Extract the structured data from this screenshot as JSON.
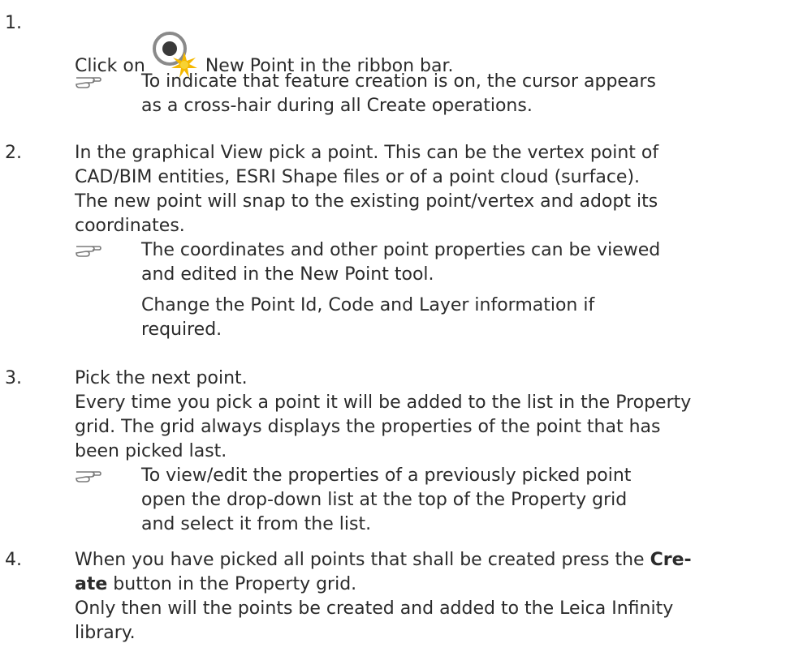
{
  "steps": [
    {
      "number": "1.",
      "line_before": "Click on",
      "icon": "new-point-icon",
      "line_after": "New Point in the ribbon bar.",
      "note_icon": "pointing-hand-icon",
      "note": [
        "To indicate that feature creation is on, the cursor appears",
        "as a cross-hair during all Create operations."
      ]
    },
    {
      "number": "2.",
      "text": [
        "In the graphical View pick a point. This can be the vertex point of",
        "CAD/BIM entities, ESRI Shape files or of a point cloud (surface).",
        "The new point will snap to the existing point/vertex and adopt its",
        "coordinates."
      ],
      "note_icon": "pointing-hand-icon",
      "note": [
        "The coordinates and other point properties can be viewed",
        "and edited in the New Point tool."
      ],
      "note_extra": [
        "Change the Point Id, Code and Layer information if",
        "required."
      ]
    },
    {
      "number": "3.",
      "text": [
        "Pick the next point.",
        "Every time you pick a point it will be added to the list in the Property",
        "grid. The grid always displays the properties of the point that has",
        "been picked last."
      ],
      "note_icon": "pointing-hand-icon",
      "note": [
        "To view/edit the properties of a previously picked point",
        "open the drop-down list at the top of the Property grid",
        "and select it from the list."
      ]
    },
    {
      "number": "4.",
      "line1_before": "When you have picked all points that shall be created press the ",
      "line1_bold": "Cre-",
      "line2_bold": "ate",
      "line2_after": " button in the Property grid.",
      "text": [
        "Only then will the points be created and added to the Leica Infinity",
        "library."
      ]
    }
  ]
}
